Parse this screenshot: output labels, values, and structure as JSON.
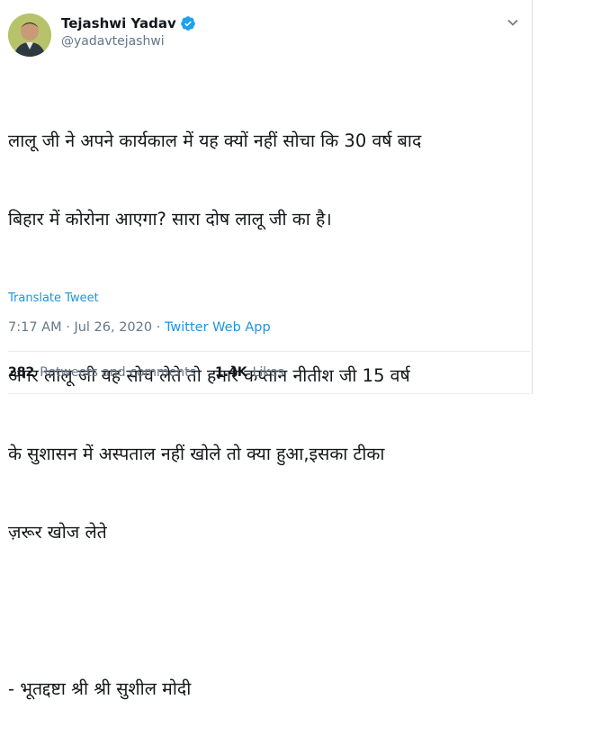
{
  "author": {
    "name": "Tejashwi Yadav",
    "handle": "@yadavtejashwi"
  },
  "tweet": {
    "lines": [
      "लालू जी ने अपने कार्यकाल में यह क्यों नहीं सोचा कि 30 वर्ष बाद",
      "बिहार में कोरोना आएगा? सारा दोष लालू जी का है।",
      "",
      "अगर लालू जी यह सोच लेते तो हमारे कप्तान नीतीश जी 15 वर्ष",
      "के सुशासन में अस्पताल नहीं खोले तो क्या हुआ,इसका टीका",
      "ज़रूर खोज लेते",
      "",
      "- भूतद्दष्टा श्री श्री सुशील मोदी"
    ],
    "translate_label": "Translate Tweet",
    "time": "7:17 AM",
    "date": "Jul 26, 2020",
    "separator": " · ",
    "source": "Twitter Web App"
  },
  "stats": {
    "retweets_count": "282",
    "retweets_label": "Retweets and comments",
    "likes_count": "1.4K",
    "likes_label": "Likes"
  },
  "colors": {
    "link": "#1b95e0",
    "muted": "#657786",
    "text": "#14171a"
  }
}
